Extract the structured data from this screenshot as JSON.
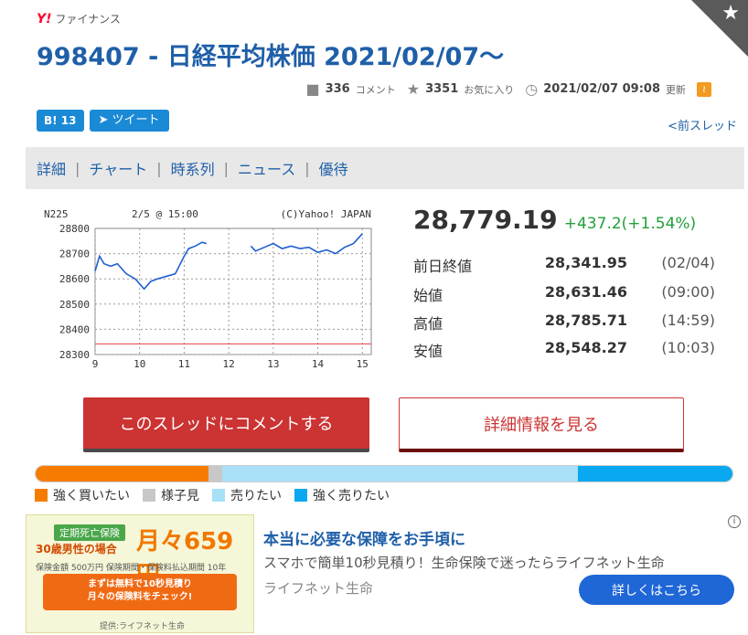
{
  "brand": {
    "logo_y": "Y!",
    "logo_text": "ファイナンス"
  },
  "corner": {
    "icon": "star-icon",
    "glyph": "★"
  },
  "title": "998407 - 日経平均株価 2021/02/07～",
  "meta": {
    "comments": "336",
    "comments_unit": "コメント",
    "favorites": "3351",
    "favorites_unit": "お気に入り",
    "updated": "2021/02/07 09:08",
    "updated_unit": "更新"
  },
  "share": {
    "hatena": "B! 13",
    "tweet": "ツイート"
  },
  "prev_thread": "<前スレッド",
  "nav": [
    "詳細",
    "チャート",
    "時系列",
    "ニュース",
    "優待"
  ],
  "chart_data": {
    "type": "line",
    "title": "2/5 @ 15:00",
    "symbol": "N225",
    "credit": "(C)Yahoo! JAPAN",
    "xlabel": "",
    "ylabel": "",
    "x_ticks": [
      "9",
      "10",
      "11",
      "12",
      "13",
      "14",
      "15"
    ],
    "y_ticks": [
      "28800",
      "28700",
      "28600",
      "28500",
      "28400",
      "28300"
    ],
    "ylim": [
      28300,
      28800
    ],
    "xlim": [
      9,
      15.2
    ],
    "grid": true,
    "reference_line": 28341.95,
    "series": [
      {
        "x": [
          9.0,
          9.1,
          9.2,
          9.35,
          9.5,
          9.7,
          9.9,
          10.1,
          10.25,
          10.4,
          10.6,
          10.8,
          11.0,
          11.1,
          11.25,
          11.4,
          11.5
        ],
        "y": [
          28631,
          28690,
          28660,
          28650,
          28660,
          28620,
          28600,
          28560,
          28590,
          28600,
          28610,
          28620,
          28690,
          28720,
          28730,
          28745,
          28740
        ]
      },
      {
        "x": [
          12.5,
          12.6,
          12.8,
          13.0,
          13.2,
          13.4,
          13.6,
          13.8,
          14.0,
          14.2,
          14.4,
          14.6,
          14.8,
          15.0
        ],
        "y": [
          28730,
          28710,
          28725,
          28740,
          28720,
          28730,
          28720,
          28725,
          28705,
          28715,
          28700,
          28725,
          28740,
          28779
        ]
      }
    ]
  },
  "price": {
    "value": "28,779.19",
    "change": "+437.2(+1.54%)"
  },
  "quotes": [
    {
      "label": "前日終値",
      "value": "28,341.95",
      "time": "(02/04)"
    },
    {
      "label": "始値",
      "value": "28,631.46",
      "time": "(09:00)"
    },
    {
      "label": "高値",
      "value": "28,785.71",
      "time": "(14:59)"
    },
    {
      "label": "安値",
      "value": "28,548.27",
      "time": "(10:03)"
    }
  ],
  "buttons": {
    "comment": "このスレッドにコメントする",
    "detail": "詳細情報を見る"
  },
  "sentiment": {
    "segments": [
      {
        "label": "強く買いたい",
        "color": "#f57c00",
        "fraction": 0.248
      },
      {
        "label": "様子見",
        "color": "#c8c8c8",
        "fraction": 0.02
      },
      {
        "label": "売りたい",
        "color": "#a8e0f8",
        "fraction": 0.51
      },
      {
        "label": "強く売りたい",
        "color": "#0aa8f0",
        "fraction": 0.222
      }
    ]
  },
  "ad": {
    "img_badge": "定期死亡保険",
    "img_age": "30歳男性の場合",
    "img_price": "月々659円",
    "img_terms": "保険金額 500万円  保険期間・保険料払込期間 10年",
    "img_cta_1": "まずは無料で10秒見積り",
    "img_cta_2": "月々の保険料をチェック!",
    "img_provider": "提供:ライフネット生命",
    "title": "本当に必要な保障をお手頃に",
    "desc": "スマホで簡単10秒見積り！生命保険で迷ったらライフネット生命",
    "sponsor": "ライフネット生命",
    "button": "詳しくはこちら",
    "info": "i"
  }
}
